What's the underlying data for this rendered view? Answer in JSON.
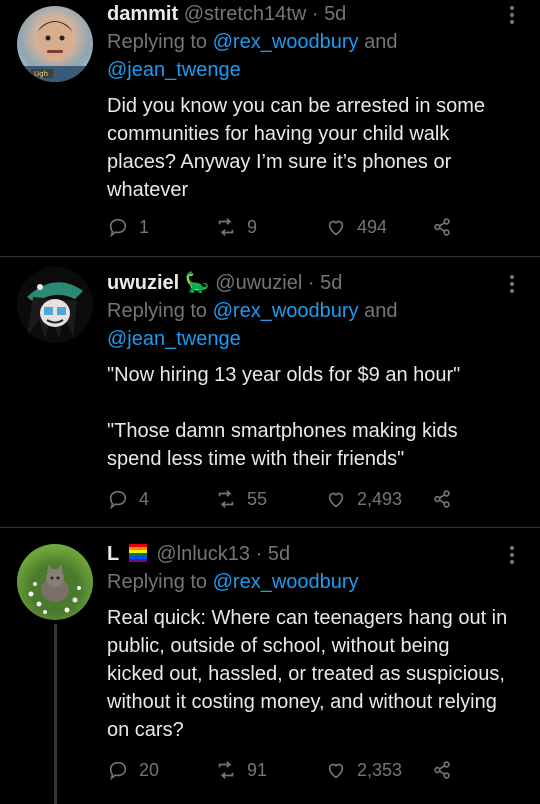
{
  "tweets": [
    {
      "name": "dammit",
      "emoji": "",
      "handle": "@stretch14tw",
      "time": "5d",
      "reply_prefix": "Replying to ",
      "reply_mention1": "@rex_woodbury",
      "reply_and": " and",
      "reply_mention2": "@jean_twenge",
      "body": "Did you know you can be arrested in some communities for having your child walk places? Anyway I’m sure it’s phones or whatever",
      "replies": "1",
      "retweets": "9",
      "likes": "494",
      "avatar_badge": "Ugh"
    },
    {
      "name": "uwuziel",
      "emoji": "🦕",
      "handle": "@uwuziel",
      "time": "5d",
      "reply_prefix": "Replying to ",
      "reply_mention1": "@rex_woodbury",
      "reply_and": " and",
      "reply_mention2": "@jean_twenge",
      "body": "\"Now hiring 13 year olds for $9 an hour\"\n\n\"Those damn smartphones making kids spend less time with their friends\"",
      "replies": "4",
      "retweets": "55",
      "likes": "2,493"
    },
    {
      "name": "L",
      "emoji": "",
      "handle": "@lnluck13",
      "time": "5d",
      "reply_prefix": "Replying to ",
      "reply_mention1": "@rex_woodbury",
      "body": "Real quick: Where can teenagers hang out in public, outside of school, without being kicked out, hassled, or treated as suspicious, without it costing money, and without relying on cars?",
      "replies": "20",
      "retweets": "91",
      "likes": "2,353"
    }
  ],
  "separator": "·",
  "colors": {
    "background": "#000000",
    "text": "#e7e9ea",
    "muted": "#71767b",
    "link": "#1d9bf0",
    "divider": "#2f3336"
  },
  "icons": {
    "reply": "reply-icon",
    "retweet": "retweet-icon",
    "like": "heart-icon",
    "share": "share-icon",
    "more": "more-icon"
  }
}
